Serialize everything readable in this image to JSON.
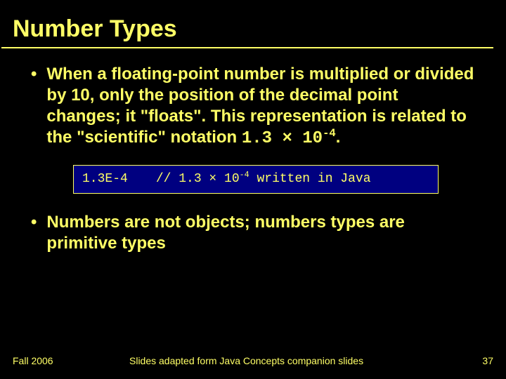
{
  "title": "Number Types",
  "bullets": {
    "b1_prefix": "When a floating-point number is multiplied or divided by 10, only the position of the decimal point changes; it \"floats\". This representation is related to the \"scientific\" notation ",
    "b1_formula_base": "1.3 × 10",
    "b1_formula_exp": "-4",
    "b1_suffix": ".",
    "b2": "Numbers are not objects; numbers types are primitive types"
  },
  "code": {
    "literal": "1.3E-4",
    "comment_prefix": "// 1.3 × 10",
    "comment_exp": "-4",
    "comment_suffix": " written in Java"
  },
  "footer": {
    "left": "Fall 2006",
    "center": "Slides adapted form Java Concepts companion slides",
    "page": "37"
  }
}
